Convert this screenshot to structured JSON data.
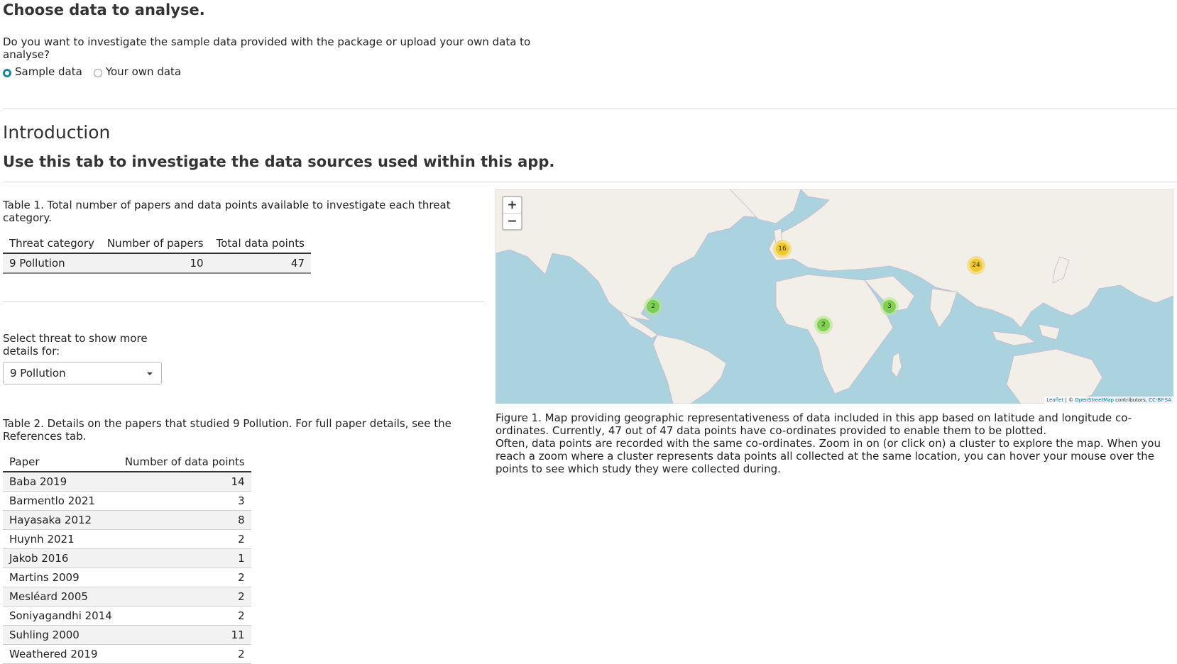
{
  "section_choose": {
    "heading": "Choose data to analyse.",
    "question": "Do you want to investigate the sample data provided with the package or upload your own data to analyse?",
    "options": [
      {
        "label": "Sample data",
        "selected": true
      },
      {
        "label": "Your own data",
        "selected": false
      }
    ]
  },
  "intro": {
    "heading": "Introduction",
    "subheading": "Use this tab to investigate the data sources used within this app."
  },
  "table1": {
    "caption": "Table 1. Total number of papers and data points available to investigate each threat category.",
    "headers": [
      "Threat category",
      "Number of papers",
      "Total data points"
    ],
    "rows": [
      [
        "9 Pollution",
        "10",
        "47"
      ]
    ]
  },
  "threat_select": {
    "label": "Select threat to show more details for:",
    "value": "9 Pollution"
  },
  "table2": {
    "caption": "Table 2. Details on the papers that studied 9 Pollution. For full paper details, see the References tab.",
    "headers": [
      "Paper",
      "Number of data points"
    ],
    "rows": [
      [
        "Baba 2019",
        "14"
      ],
      [
        "Barmentlo 2021",
        "3"
      ],
      [
        "Hayasaka 2012",
        "8"
      ],
      [
        "Huynh 2021",
        "2"
      ],
      [
        "Jakob 2016",
        "1"
      ],
      [
        "Martins 2009",
        "2"
      ],
      [
        "Mesléard 2005",
        "2"
      ],
      [
        "Soniyagandhi 2014",
        "2"
      ],
      [
        "Suhling 2000",
        "11"
      ],
      [
        "Weathered 2019",
        "2"
      ]
    ]
  },
  "map": {
    "zoom_in": "+",
    "zoom_out": "−",
    "attribution": {
      "leaflet": "Leaflet",
      "sep": " | © ",
      "osm": "OpenStreetMap",
      "mid": " contributors, ",
      "license": "CC-BY-SA"
    },
    "clusters": [
      {
        "count": "16",
        "color": "yellow"
      },
      {
        "count": "24",
        "color": "yellow"
      },
      {
        "count": "2",
        "color": "green"
      },
      {
        "count": "3",
        "color": "green"
      },
      {
        "count": "2",
        "color": "green"
      }
    ],
    "colors": {
      "water": "#aad3df",
      "land": "#f2efe9",
      "border": "#c9b8c9"
    }
  },
  "figure": {
    "caption_line1": "Figure 1. Map providing geographic representativeness of data included in this app based on latitude and longitude co-ordinates. Currently, 47 out of 47 data points have co-ordinates provided to enable them to be plotted.",
    "caption_line2": "Often, data points are recorded with the same co-ordinates. Zoom in on (or click on) a cluster to explore the map. When you reach a zoom where a cluster represents data points all collected at the same location, you can hover your mouse over the points to see which study they were collected during."
  }
}
